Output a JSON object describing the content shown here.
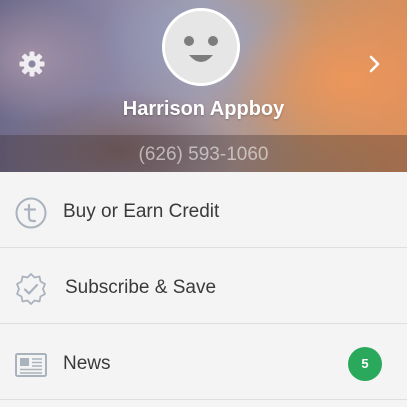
{
  "profile": {
    "name": "Harrison Appboy",
    "phone": "(626) 593-1060"
  },
  "icons": {
    "settings": "gear-icon",
    "next": "chevron-right-icon",
    "avatar": "smiley-face-icon"
  },
  "menu": {
    "items": [
      {
        "label": "Buy or Earn Credit",
        "icon": "credit-t-icon"
      },
      {
        "label": "Subscribe & Save",
        "icon": "check-badge-icon"
      },
      {
        "label": "News",
        "icon": "newspaper-icon",
        "badge": "5"
      }
    ]
  },
  "colors": {
    "badge": "#2aa85c",
    "icon": "#aab3bd",
    "text": "#3a3a3a"
  }
}
